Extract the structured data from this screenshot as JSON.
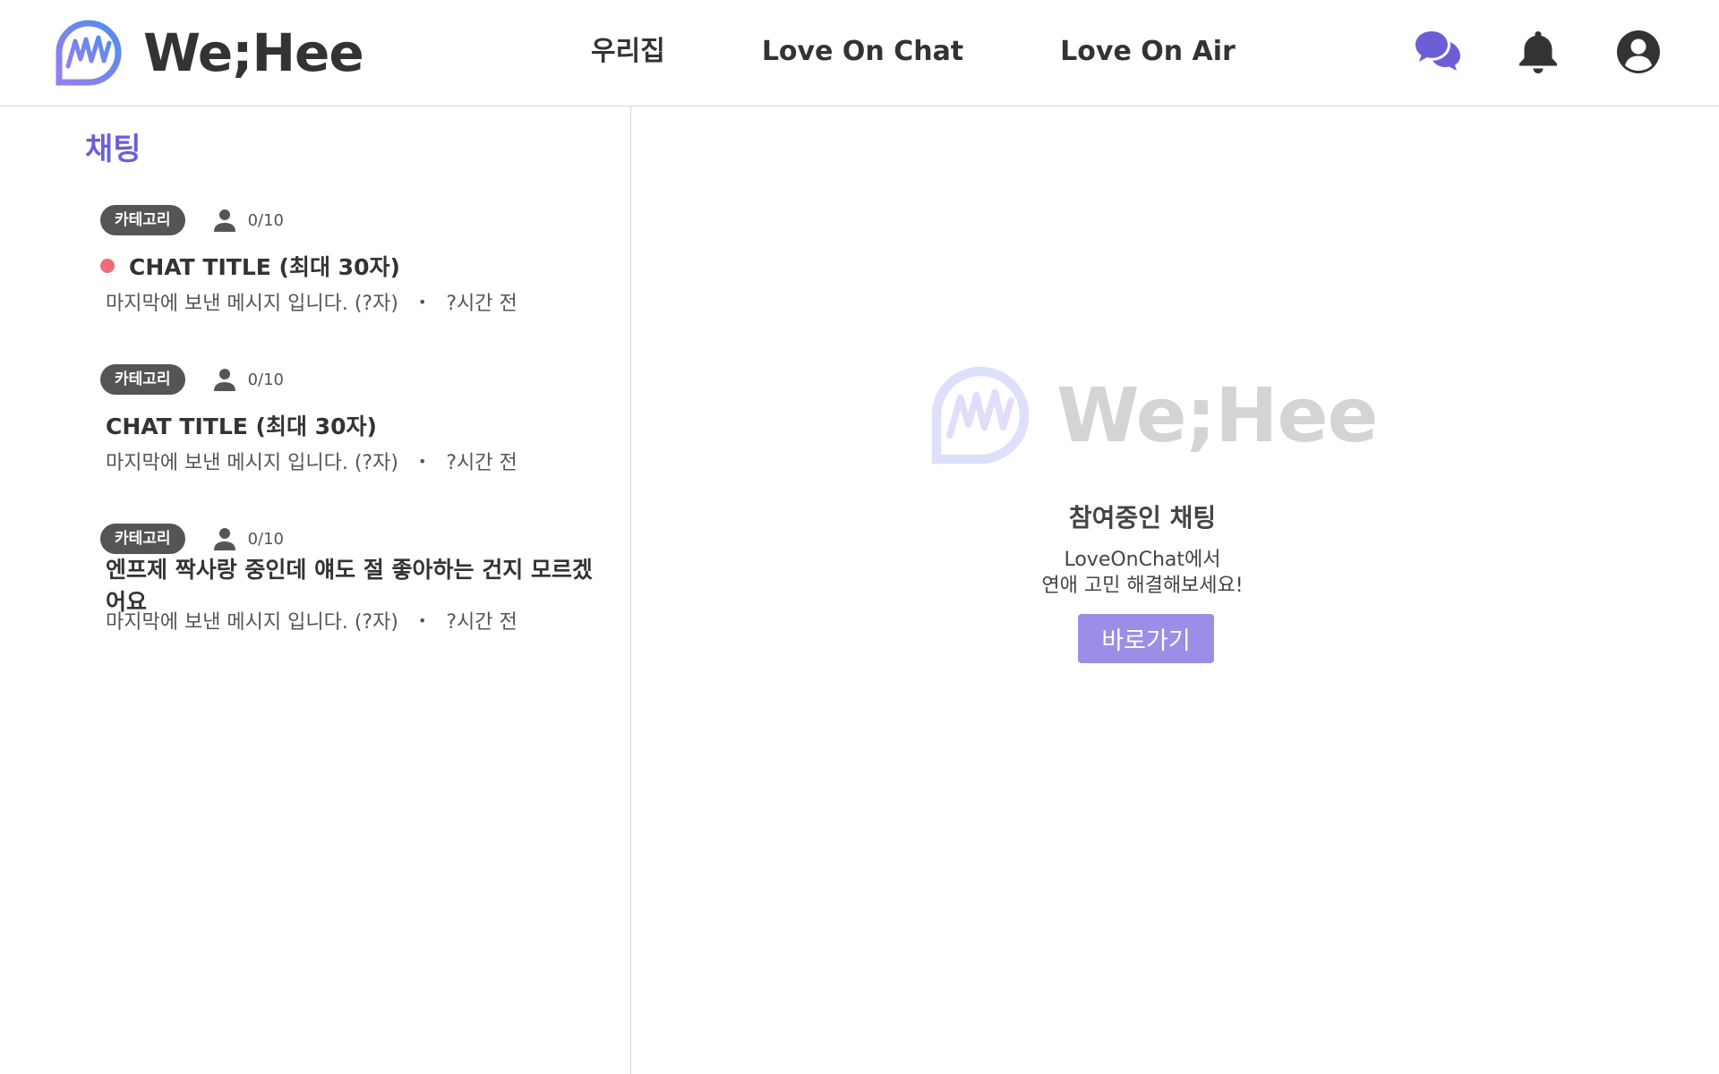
{
  "header": {
    "logo_text": "We;Hee",
    "nav": [
      {
        "label": "우리집"
      },
      {
        "label": "Love On Chat"
      },
      {
        "label": "Love On Air"
      }
    ],
    "icons": [
      "chat-bubbles-icon",
      "bell-icon",
      "user-circle-icon"
    ],
    "colors": {
      "accent": "#6b5fd6",
      "chat_icon": "#6b5fd6",
      "icon_dark": "#333333"
    }
  },
  "sidebar": {
    "title": "채팅",
    "chats": [
      {
        "category": "카테고리",
        "count": "0/10",
        "unread": true,
        "title": "CHAT TITLE  (최대 30자)",
        "last_message": "마지막에 보낸 메시지 입니다. (?자)",
        "separator": "•",
        "time": "?시간 전"
      },
      {
        "category": "카테고리",
        "count": "0/10",
        "unread": false,
        "title": "CHAT TITLE  (최대 30자)",
        "last_message": "마지막에 보낸 메시지 입니다. (?자)",
        "separator": "•",
        "time": "?시간 전"
      },
      {
        "category": "카테고리",
        "count": "0/10",
        "unread": false,
        "title": "엔프제 짝사랑 중인데 얘도 절 좋아하는 건지 모르겠어요",
        "last_message": "마지막에 보낸 메시지 입니다. (?자)",
        "separator": "•",
        "time": "?시간 전"
      }
    ],
    "colors": {
      "badge_bg": "#555555",
      "unread_dot": "#f06b7a"
    }
  },
  "main": {
    "logo_text": "We;Hee",
    "empty_title": "참여중인 채팅",
    "empty_desc_line1": "LoveOnChat에서",
    "empty_desc_line2": "연애 고민 해결해보세요!",
    "go_button": "바로가기",
    "colors": {
      "button_bg": "#9b8ee6",
      "logo_faded": "#d4d4d4"
    }
  }
}
